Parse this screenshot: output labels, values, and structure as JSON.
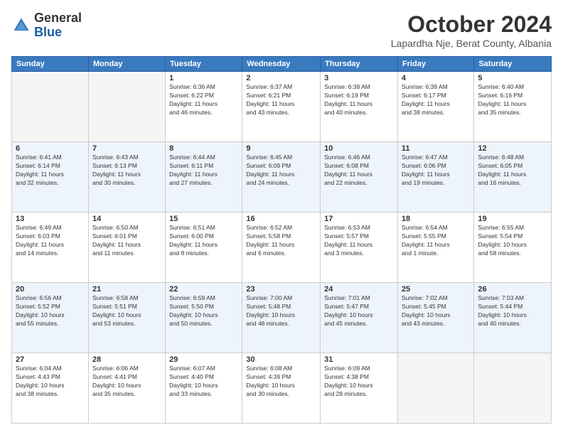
{
  "logo": {
    "general": "General",
    "blue": "Blue"
  },
  "header": {
    "month": "October 2024",
    "location": "Lapardha Nje, Berat County, Albania"
  },
  "weekdays": [
    "Sunday",
    "Monday",
    "Tuesday",
    "Wednesday",
    "Thursday",
    "Friday",
    "Saturday"
  ],
  "weeks": [
    [
      {
        "day": "",
        "info": ""
      },
      {
        "day": "",
        "info": ""
      },
      {
        "day": "1",
        "info": "Sunrise: 6:36 AM\nSunset: 6:22 PM\nDaylight: 11 hours\nand 46 minutes."
      },
      {
        "day": "2",
        "info": "Sunrise: 6:37 AM\nSunset: 6:21 PM\nDaylight: 11 hours\nand 43 minutes."
      },
      {
        "day": "3",
        "info": "Sunrise: 6:38 AM\nSunset: 6:19 PM\nDaylight: 11 hours\nand 40 minutes."
      },
      {
        "day": "4",
        "info": "Sunrise: 6:39 AM\nSunset: 6:17 PM\nDaylight: 11 hours\nand 38 minutes."
      },
      {
        "day": "5",
        "info": "Sunrise: 6:40 AM\nSunset: 6:16 PM\nDaylight: 11 hours\nand 35 minutes."
      }
    ],
    [
      {
        "day": "6",
        "info": "Sunrise: 6:41 AM\nSunset: 6:14 PM\nDaylight: 11 hours\nand 32 minutes."
      },
      {
        "day": "7",
        "info": "Sunrise: 6:43 AM\nSunset: 6:13 PM\nDaylight: 11 hours\nand 30 minutes."
      },
      {
        "day": "8",
        "info": "Sunrise: 6:44 AM\nSunset: 6:11 PM\nDaylight: 11 hours\nand 27 minutes."
      },
      {
        "day": "9",
        "info": "Sunrise: 6:45 AM\nSunset: 6:09 PM\nDaylight: 11 hours\nand 24 minutes."
      },
      {
        "day": "10",
        "info": "Sunrise: 6:46 AM\nSunset: 6:08 PM\nDaylight: 11 hours\nand 22 minutes."
      },
      {
        "day": "11",
        "info": "Sunrise: 6:47 AM\nSunset: 6:06 PM\nDaylight: 11 hours\nand 19 minutes."
      },
      {
        "day": "12",
        "info": "Sunrise: 6:48 AM\nSunset: 6:05 PM\nDaylight: 11 hours\nand 16 minutes."
      }
    ],
    [
      {
        "day": "13",
        "info": "Sunrise: 6:49 AM\nSunset: 6:03 PM\nDaylight: 11 hours\nand 14 minutes."
      },
      {
        "day": "14",
        "info": "Sunrise: 6:50 AM\nSunset: 6:01 PM\nDaylight: 11 hours\nand 11 minutes."
      },
      {
        "day": "15",
        "info": "Sunrise: 6:51 AM\nSunset: 6:00 PM\nDaylight: 11 hours\nand 8 minutes."
      },
      {
        "day": "16",
        "info": "Sunrise: 6:52 AM\nSunset: 5:58 PM\nDaylight: 11 hours\nand 6 minutes."
      },
      {
        "day": "17",
        "info": "Sunrise: 6:53 AM\nSunset: 5:57 PM\nDaylight: 11 hours\nand 3 minutes."
      },
      {
        "day": "18",
        "info": "Sunrise: 6:54 AM\nSunset: 5:55 PM\nDaylight: 11 hours\nand 1 minute."
      },
      {
        "day": "19",
        "info": "Sunrise: 6:55 AM\nSunset: 5:54 PM\nDaylight: 10 hours\nand 58 minutes."
      }
    ],
    [
      {
        "day": "20",
        "info": "Sunrise: 6:56 AM\nSunset: 5:52 PM\nDaylight: 10 hours\nand 55 minutes."
      },
      {
        "day": "21",
        "info": "Sunrise: 6:58 AM\nSunset: 5:51 PM\nDaylight: 10 hours\nand 53 minutes."
      },
      {
        "day": "22",
        "info": "Sunrise: 6:59 AM\nSunset: 5:50 PM\nDaylight: 10 hours\nand 50 minutes."
      },
      {
        "day": "23",
        "info": "Sunrise: 7:00 AM\nSunset: 5:48 PM\nDaylight: 10 hours\nand 48 minutes."
      },
      {
        "day": "24",
        "info": "Sunrise: 7:01 AM\nSunset: 5:47 PM\nDaylight: 10 hours\nand 45 minutes."
      },
      {
        "day": "25",
        "info": "Sunrise: 7:02 AM\nSunset: 5:45 PM\nDaylight: 10 hours\nand 43 minutes."
      },
      {
        "day": "26",
        "info": "Sunrise: 7:03 AM\nSunset: 5:44 PM\nDaylight: 10 hours\nand 40 minutes."
      }
    ],
    [
      {
        "day": "27",
        "info": "Sunrise: 6:04 AM\nSunset: 4:43 PM\nDaylight: 10 hours\nand 38 minutes."
      },
      {
        "day": "28",
        "info": "Sunrise: 6:06 AM\nSunset: 4:41 PM\nDaylight: 10 hours\nand 35 minutes."
      },
      {
        "day": "29",
        "info": "Sunrise: 6:07 AM\nSunset: 4:40 PM\nDaylight: 10 hours\nand 33 minutes."
      },
      {
        "day": "30",
        "info": "Sunrise: 6:08 AM\nSunset: 4:39 PM\nDaylight: 10 hours\nand 30 minutes."
      },
      {
        "day": "31",
        "info": "Sunrise: 6:09 AM\nSunset: 4:38 PM\nDaylight: 10 hours\nand 28 minutes."
      },
      {
        "day": "",
        "info": ""
      },
      {
        "day": "",
        "info": ""
      }
    ]
  ]
}
